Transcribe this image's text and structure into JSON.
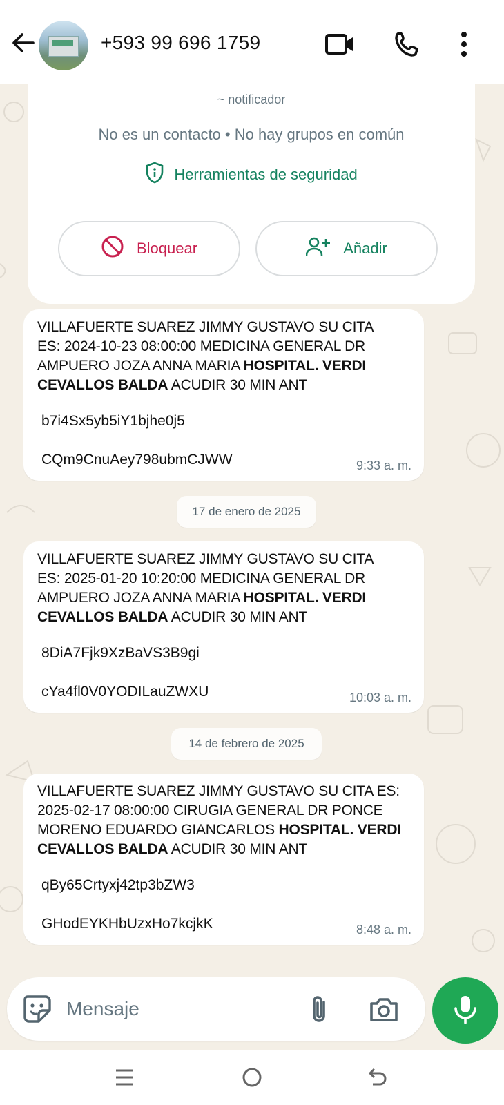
{
  "header": {
    "contact_name": "+593 99 696 1759",
    "icons": [
      "back-arrow-icon",
      "video-call-icon",
      "phone-icon",
      "more-vert-icon"
    ]
  },
  "info_card": {
    "notifier_name": "~ notificador",
    "subtitle": "No es un contacto • No hay grupos en común",
    "security_label": "Herramientas de seguridad",
    "block_label": "Bloquear",
    "add_label": "Añadir",
    "colors": {
      "block": "#c8204f",
      "add": "#15825f"
    }
  },
  "messages": [
    {
      "line1": "VILLAFUERTE SUAREZ JIMMY GUSTAVO SU CITA",
      "line2": "ES: 2024-10-23 08:00:00 MEDICINA GENERAL DR",
      "line3": "AMPUERO JOZA ANNA MARIA ",
      "bold3": " HOSPITAL. VERDI",
      "bold4": "CEVALLOS BALDA",
      "rest4": " ACUDIR 30 MIN ANT",
      "code1": "b7i4Sx5yb5iY1bjhe0j5",
      "code2": "CQm9CnuAey798ubmCJWW",
      "time": "9:33 a. m."
    },
    {
      "line1": "VILLAFUERTE SUAREZ JIMMY GUSTAVO SU CITA",
      "line2": "ES: 2025-01-20 10:20:00 MEDICINA GENERAL DR",
      "line3": "AMPUERO JOZA ANNA MARIA ",
      "bold3": " HOSPITAL. VERDI",
      "bold4": "CEVALLOS BALDA",
      "rest4": " ACUDIR 30 MIN ANT",
      "code1": "8DiA7Fjk9XzBaVS3B9gi",
      "code2": "cYa4fl0V0YODILauZWXU",
      "time": "10:03 a. m."
    },
    {
      "line1": "VILLAFUERTE SUAREZ JIMMY GUSTAVO SU CITA ES:",
      "line2": "2025-02-17 08:00:00 CIRUGIA GENERAL DR PONCE",
      "line3": "MORENO EDUARDO GIANCARLOS ",
      "bold3": " HOSPITAL. VERDI",
      "bold4": "CEVALLOS BALDA",
      "rest4": " ACUDIR 30 MIN ANT",
      "code1": "qBy65Crtyxj42tp3bZW3",
      "code2": "GHodEYKHbUzxHo7kcjkK",
      "time": "8:48 a. m."
    }
  ],
  "date_chips": [
    "17 de enero de 2025",
    "14 de febrero de 2025"
  ],
  "composer": {
    "placeholder": "Mensaje",
    "icons": [
      "sticker-icon",
      "attach-icon",
      "camera-icon",
      "mic-icon"
    ],
    "accent": "#1fa855"
  },
  "navbar": {
    "icons": [
      "recent-apps-icon",
      "home-icon",
      "back-icon"
    ]
  }
}
